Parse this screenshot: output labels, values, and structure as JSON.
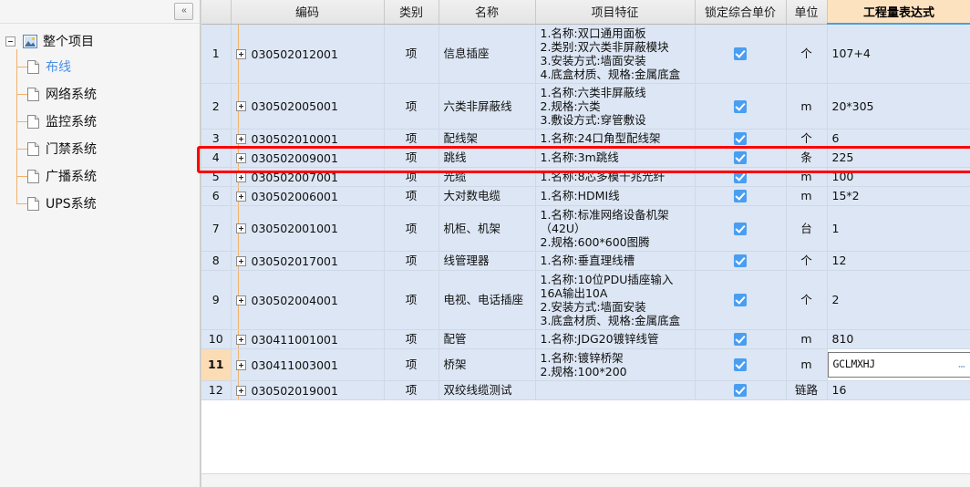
{
  "sidebar": {
    "collapse_label": "«",
    "root": {
      "label": "整个项目",
      "icon": "project-folder-icon"
    },
    "items": [
      {
        "label": "布线",
        "selected": true
      },
      {
        "label": "网络系统",
        "selected": false
      },
      {
        "label": "监控系统",
        "selected": false
      },
      {
        "label": "门禁系统",
        "selected": false
      },
      {
        "label": "广播系统",
        "selected": false
      },
      {
        "label": "UPS系统",
        "selected": false
      }
    ]
  },
  "table": {
    "columns": [
      {
        "key": "rownum",
        "label": ""
      },
      {
        "key": "code",
        "label": "编码"
      },
      {
        "key": "cat",
        "label": "类别"
      },
      {
        "key": "name",
        "label": "名称"
      },
      {
        "key": "feat",
        "label": "项目特征"
      },
      {
        "key": "lock",
        "label": "锁定综合单价"
      },
      {
        "key": "unit",
        "label": "单位"
      },
      {
        "key": "expr",
        "label": "工程量表达式",
        "highlighted": true
      }
    ],
    "rows": [
      {
        "num": "1",
        "code": "030502012001",
        "cat": "项",
        "name": "信息插座",
        "feat": [
          "1.名称:双口通用面板",
          "2.类别:双六类非屏蔽模块",
          "3.安装方式:墙面安装",
          "4.底盒材质、规格:金属底盒"
        ],
        "lock": true,
        "unit": "个",
        "expr": "107+4"
      },
      {
        "num": "2",
        "code": "030502005001",
        "cat": "项",
        "name": "六类非屏蔽线",
        "feat": [
          "1.名称:六类非屏蔽线",
          "2.规格:六类",
          "3.敷设方式:穿管敷设"
        ],
        "lock": true,
        "unit": "m",
        "expr": "20*305"
      },
      {
        "num": "3",
        "code": "030502010001",
        "cat": "项",
        "name": "配线架",
        "feat": [
          "1.名称:24口角型配线架"
        ],
        "lock": true,
        "unit": "个",
        "expr": "6"
      },
      {
        "num": "4",
        "code": "030502009001",
        "cat": "项",
        "name": "跳线",
        "feat": [
          "1.名称:3m跳线"
        ],
        "lock": true,
        "unit": "条",
        "expr": "225",
        "annotated": true
      },
      {
        "num": "5",
        "code": "030502007001",
        "cat": "项",
        "name": "光缆",
        "feat": [
          "1.名称:8芯多模千兆光纤"
        ],
        "lock": true,
        "unit": "m",
        "expr": "100"
      },
      {
        "num": "6",
        "code": "030502006001",
        "cat": "项",
        "name": "大对数电缆",
        "feat": [
          "1.名称:HDMI线"
        ],
        "lock": true,
        "unit": "m",
        "expr": "15*2"
      },
      {
        "num": "7",
        "code": "030502001001",
        "cat": "项",
        "name": "机柜、机架",
        "feat": [
          "1.名称:标准网络设备机架（42U）",
          "2.规格:600*600图腾"
        ],
        "lock": true,
        "unit": "台",
        "expr": "1"
      },
      {
        "num": "8",
        "code": "030502017001",
        "cat": "项",
        "name": "线管理器",
        "feat": [
          "1.名称:垂直理线槽"
        ],
        "lock": true,
        "unit": "个",
        "expr": "12"
      },
      {
        "num": "9",
        "code": "030502004001",
        "cat": "项",
        "name": "电视、电话插座",
        "feat": [
          "1.名称:10位PDU插座输入16A输出10A",
          "2.安装方式:墙面安装",
          "3.底盒材质、规格:金属底盒"
        ],
        "lock": true,
        "unit": "个",
        "expr": "2"
      },
      {
        "num": "10",
        "code": "030411001001",
        "cat": "项",
        "name": "配管",
        "feat": [
          "1.名称:JDG20镀锌线管"
        ],
        "lock": true,
        "unit": "m",
        "expr": "810"
      },
      {
        "num": "11",
        "code": "030411003001",
        "cat": "项",
        "name": "桥架",
        "feat": [
          "1.名称:镀锌桥架",
          "2.规格:100*200"
        ],
        "lock": true,
        "unit": "m",
        "expr": "GCLMXHJ",
        "selected": true,
        "editing": true,
        "editor_button": "…"
      },
      {
        "num": "12",
        "code": "030502019001",
        "cat": "项",
        "name": "双绞线缆测试",
        "feat": [],
        "lock": true,
        "unit": "链路",
        "expr": "16"
      }
    ]
  },
  "colors": {
    "row_bg": "#dce6f4",
    "header_highlight": "#fde2c0",
    "checkbox": "#4a9ef0",
    "annotation": "#ff0000",
    "selected_row_num": "#fcdcb5",
    "tree_link": "#4a8fe8"
  }
}
